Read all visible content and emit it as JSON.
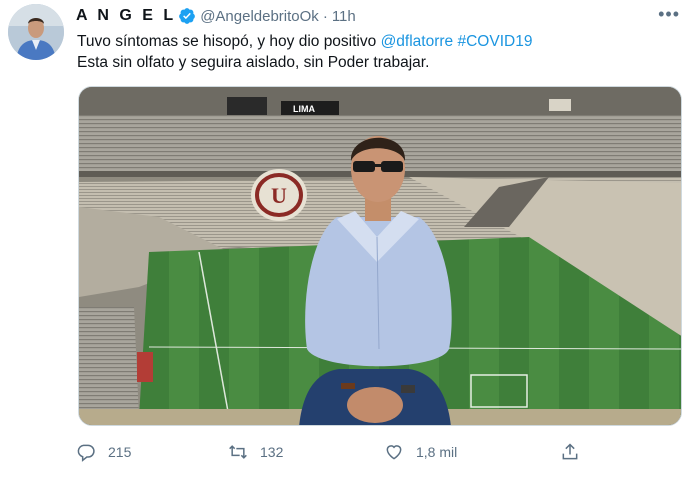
{
  "tweet": {
    "author_name": "A N G E L",
    "handle": "@AngeldebritoOk",
    "separator": "·",
    "time": "11h",
    "more_label": "•••",
    "line1_text": "Tuvo síntomas se hisopó, y hoy dio positivo ",
    "mention": "@dflatorre",
    "hashtag": "#COVID19",
    "line2_text": "Esta sin olfato y seguira aislado, sin Poder trabajar.",
    "media_banner": "LIMA"
  },
  "actions": {
    "replies": "215",
    "retweets": "132",
    "likes": "1,8 mil"
  },
  "colors": {
    "link": "#1b95e0",
    "secondary_text": "#5b7083",
    "verified": "#1da1f2"
  },
  "icons": [
    "verified-badge-icon",
    "more-options-icon",
    "reply-icon",
    "retweet-icon",
    "like-icon",
    "share-icon"
  ]
}
